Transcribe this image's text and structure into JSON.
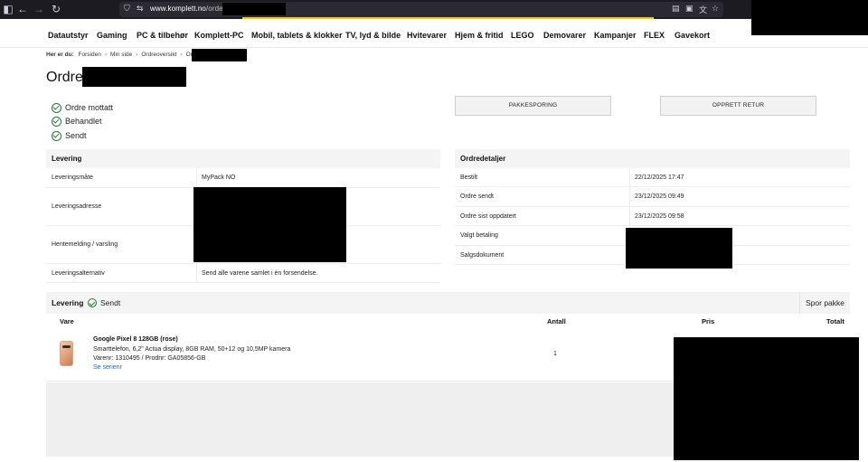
{
  "browser": {
    "url_host": "www.komplett.no",
    "url_path": "/orders/"
  },
  "nav": {
    "items": [
      "Datautstyr",
      "Gaming",
      "PC & tilbehør",
      "Komplett-PC",
      "Mobil, tablets & klokker",
      "TV, lyd & bilde",
      "Hvitevarer",
      "Hjem & fritid",
      "LEGO",
      "Demovarer",
      "Kampanjer",
      "FLEX",
      "Gavekort"
    ]
  },
  "breadcrumb": {
    "label": "Her er du:",
    "items": [
      "Forsiden",
      "Min side",
      "Ordreoversikt",
      "Ordre"
    ]
  },
  "page": {
    "title": "Ordre"
  },
  "status": {
    "steps": [
      "Ordre mottatt",
      "Behandlet",
      "Sendt"
    ]
  },
  "actions": {
    "tracking": "PAKKESPORING",
    "return": "OPPRETT RETUR"
  },
  "delivery_panel": {
    "title": "Levering",
    "rows": [
      {
        "label": "Leveringsmåte",
        "value": "MyPack NO"
      },
      {
        "label": "Leveringsadresse",
        "value": ""
      },
      {
        "label": "Hentemelding / varsling",
        "value": ""
      },
      {
        "label": "Leveringsalternativ",
        "value": "Send alle varene samlet i én forsendelse."
      }
    ]
  },
  "order_panel": {
    "title": "Ordredetaljer",
    "rows": [
      {
        "label": "Bestilt",
        "value": "22/12/2025 17:47"
      },
      {
        "label": "Ordre sendt",
        "value": "23/12/2025 09:49"
      },
      {
        "label": "Ordre sist oppdatert",
        "value": "23/12/2025 09:58"
      },
      {
        "label": "Valgt betaling",
        "value": ""
      },
      {
        "label": "Salgsdokument",
        "value": ""
      }
    ]
  },
  "shipment": {
    "title": "Levering",
    "state": "Sendt",
    "track_label": "Spor pakke",
    "columns": {
      "item": "Vare",
      "qty": "Antall",
      "price": "Pris",
      "total": "Totalt"
    }
  },
  "product": {
    "name": "Google Pixel 8 128GB (rose)",
    "description": "Smarttelefon, 6,2\" Actua display, 8GB RAM, 50+12 og 10,5MP kamera",
    "numbers": "Varenr: 1310495 / Prodnr: GA05856-GB",
    "serial_link": "Se serienr",
    "quantity": "1",
    "image_icon": "phone-product-image"
  },
  "colors": {
    "check": "#1f7a35",
    "link": "#1769c2",
    "accent": "#f6c900"
  }
}
